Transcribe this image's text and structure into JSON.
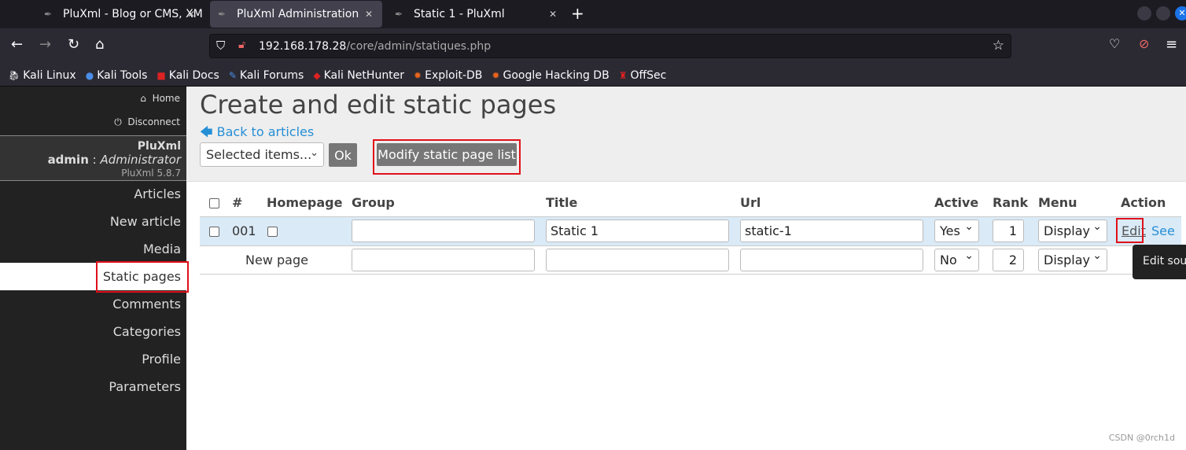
{
  "browser": {
    "tabs": [
      {
        "label": "PluXml - Blog or CMS, XM",
        "active": false
      },
      {
        "label": "PluXml Administration",
        "active": true
      },
      {
        "label": "Static 1 - PluXml",
        "active": false
      }
    ],
    "new_tab": "+",
    "url_host": "192.168.178.28",
    "url_path": "/core/admin/statiques.php",
    "bookmarks": [
      "Kali Linux",
      "Kali Tools",
      "Kali Docs",
      "Kali Forums",
      "Kali NetHunter",
      "Exploit-DB",
      "Google Hacking DB",
      "OffSec"
    ]
  },
  "sidebar": {
    "home": "Home",
    "disconnect": "Disconnect",
    "site": "PluXml",
    "user": "admin",
    "sep": " : ",
    "role": "Administrator",
    "version": "PluXml 5.8.7",
    "items": [
      "Articles",
      "New article",
      "Media",
      "Static pages",
      "Comments",
      "Categories",
      "Profile",
      "Parameters"
    ],
    "selected": "Static pages"
  },
  "main": {
    "title": "Create and edit static pages",
    "back": "Back to articles",
    "bulk_select": "Selected items...",
    "ok": "Ok",
    "modify": "Modify static page list",
    "columns": [
      "#",
      "Homepage",
      "Group",
      "Title",
      "Url",
      "Active",
      "Rank",
      "Menu",
      "Action"
    ],
    "rows": [
      {
        "id": "001",
        "group": "",
        "title": "Static 1",
        "url": "static-1",
        "active": "Yes",
        "rank": "1",
        "menu": "Display",
        "edit": "Edit",
        "see": "See"
      },
      {
        "id": "New page",
        "group": "",
        "title": "",
        "url": "",
        "active": "No",
        "rank": "2",
        "menu": "Display"
      }
    ],
    "tooltip": "Edit sour"
  },
  "watermark": "CSDN @0rch1d",
  "colors": {
    "link": "#258fd6",
    "highlight": "#e0101a",
    "sidebar": "#222222",
    "row_hover": "#daeaf7"
  }
}
